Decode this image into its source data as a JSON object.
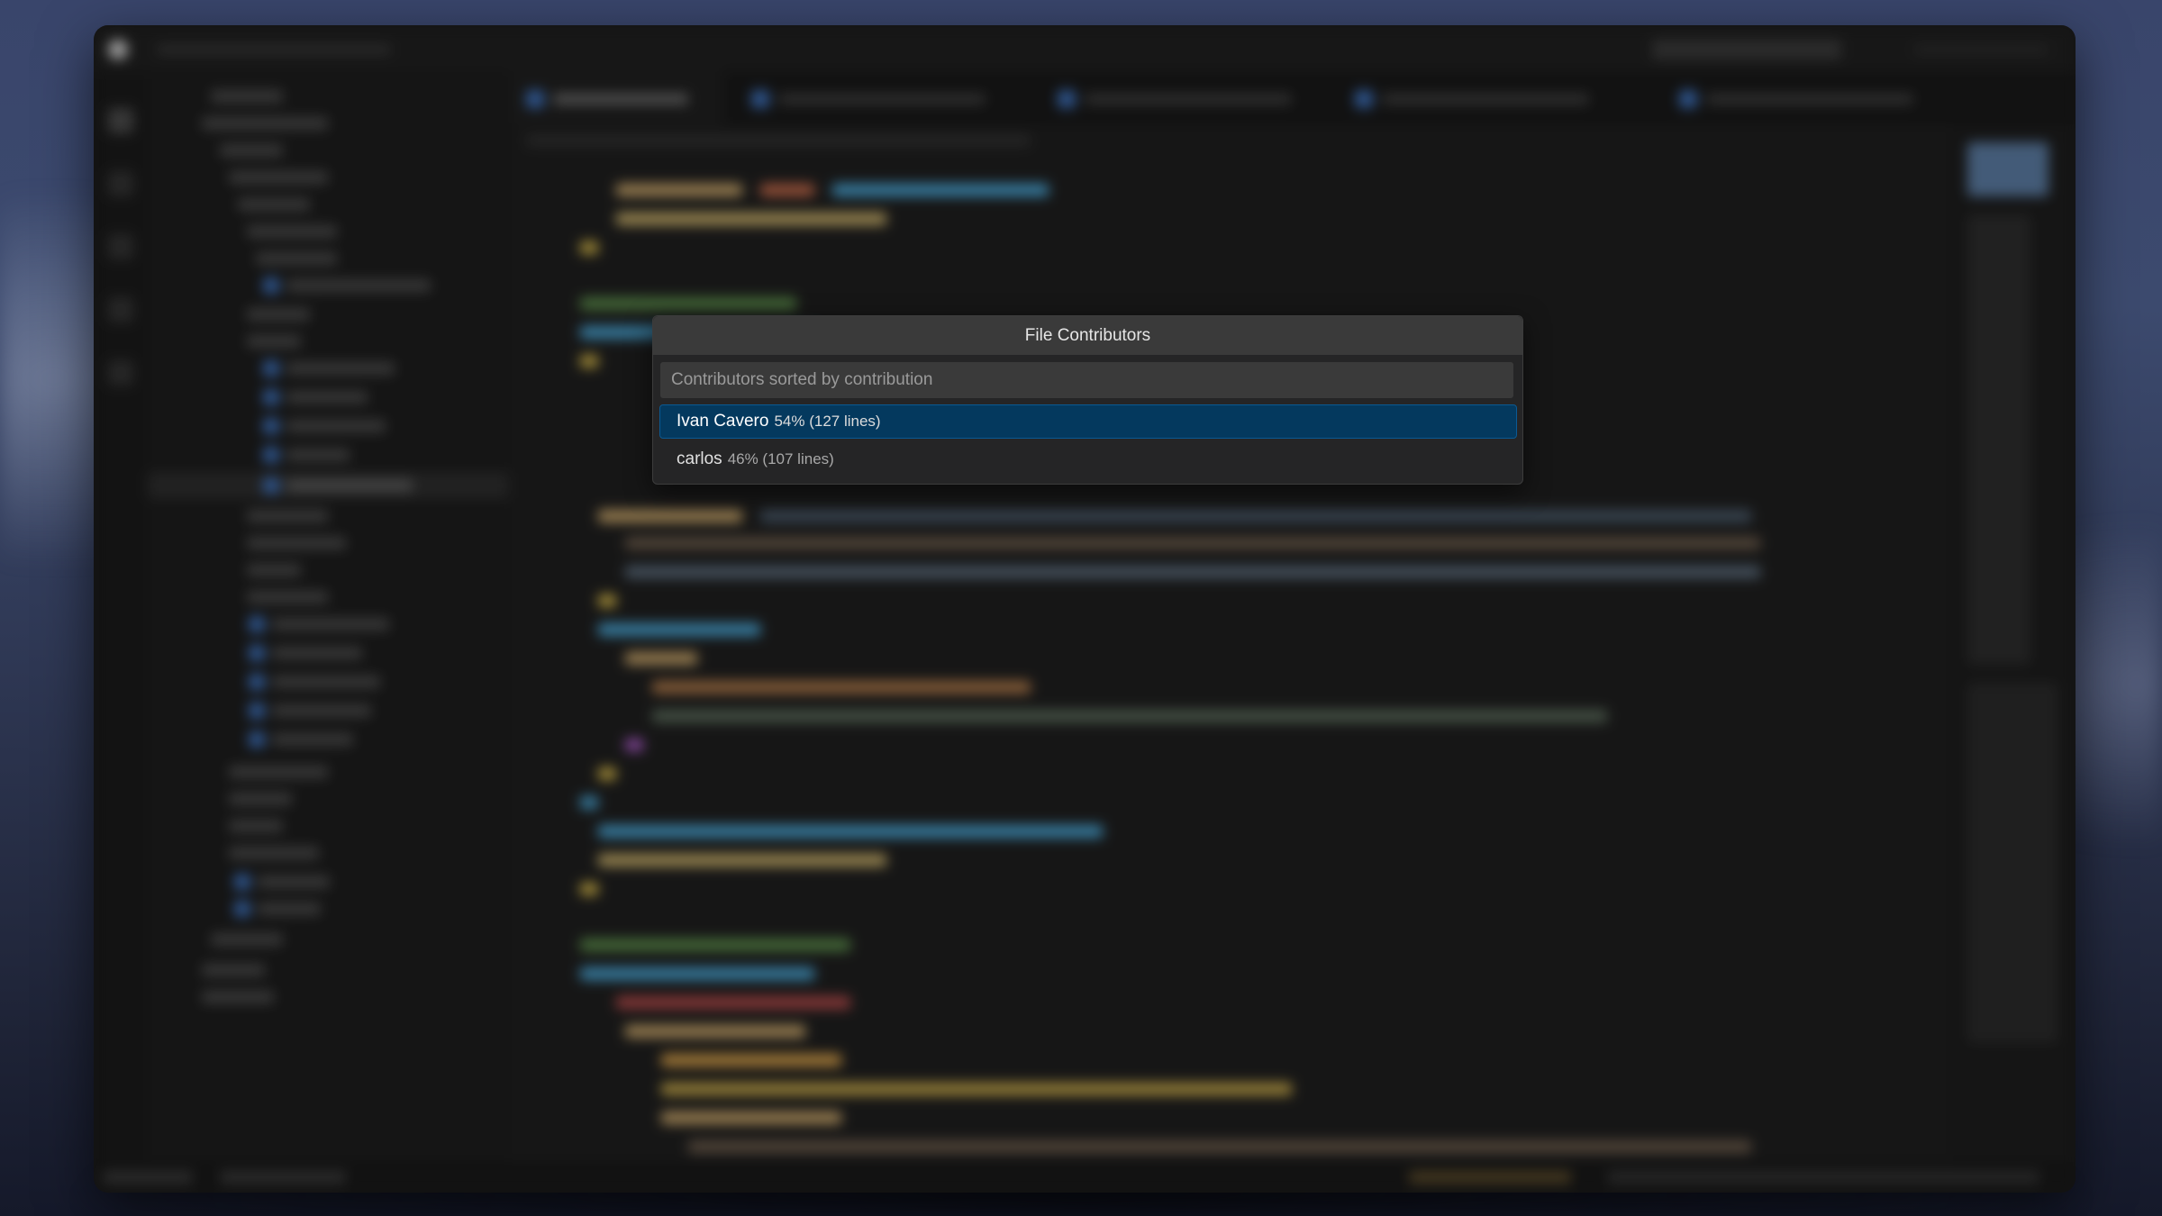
{
  "dialog": {
    "title": "File Contributors",
    "input": {
      "placeholder": "Contributors sorted by contribution",
      "value": ""
    },
    "items": [
      {
        "name": "Ivan Cavero",
        "detail": "54% (127 lines)",
        "selected": true
      },
      {
        "name": "carlos",
        "detail": "46% (107 lines)",
        "selected": false
      }
    ]
  },
  "colors": {
    "dialog_background": "#252526",
    "title_background": "#3a3a3a",
    "selection_background": "#04395e",
    "editor_background": "#1e1e1e"
  }
}
